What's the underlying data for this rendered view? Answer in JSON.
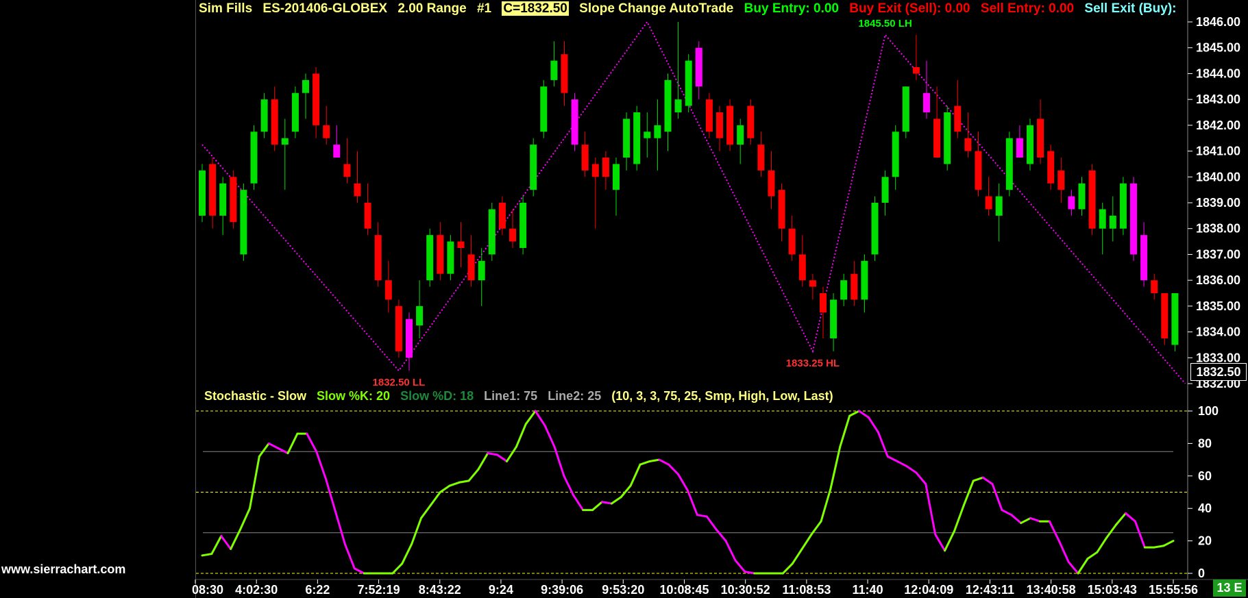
{
  "watermark": "www.sierrachart.com",
  "header": {
    "sim": "Sim Fills",
    "symbol": "ES-201406-GLOBEX",
    "range": "2.00 Range",
    "chart_num": "#1",
    "close": "C=1832.50",
    "study": "Slope Change AutoTrade",
    "buy_entry": "Buy Entry: 0.00",
    "buy_exit": "Buy Exit (Sell): 0.00",
    "sell_entry": "Sell Entry: 0.00",
    "sell_exit": "Sell Exit (Buy):"
  },
  "stoch_header": {
    "name": "Stochastic - Slow",
    "k": "Slow %K: 20",
    "d": "Slow %D: 18",
    "line1": "Line1: 75",
    "line2": "Line2: 25",
    "params": "(10, 3, 3, 75, 25, Smp, High, Low, Last)"
  },
  "current_price": "1832.50",
  "bar_count": "13 E",
  "colors": {
    "up": "#00e000",
    "down": "#ff0000",
    "magenta": "#ff00ff",
    "stoch_up": "#80ff00",
    "header_green": "#00ff00",
    "header_red": "#ff0000",
    "header_cyan": "#80ffff",
    "header_yellow": "#ffff80"
  },
  "chart_data": [
    {
      "type": "candlestick",
      "yaxis_ticks": [
        1846,
        1845,
        1844,
        1843,
        1842,
        1841,
        1840,
        1839,
        1838,
        1837,
        1836,
        1835,
        1834,
        1833,
        1832
      ],
      "ylim": [
        1832,
        1846
      ],
      "x_ticks": [
        "08:30",
        "4:02:30",
        "6:22",
        "7:52:19",
        "8:43:22",
        "9:24",
        "9:39:06",
        "9:53:20",
        "10:08:45",
        "10:30:52",
        "11:08:53",
        "11:40",
        "12:04:09",
        "12:43:11",
        "13:40:58",
        "15:03:43",
        "15:55:56"
      ],
      "swing_labels": [
        {
          "text": "1832.50 LL",
          "price": 1832.5,
          "color": "#ff3030"
        },
        {
          "text": "1845.50 LH",
          "price": 1845.5,
          "color": "#00ff00"
        },
        {
          "text": "1833.25 HL",
          "price": 1833.25,
          "color": "#ff3030"
        }
      ],
      "zigzag": [
        {
          "bar": 0,
          "price": 1841.25
        },
        {
          "bar": 19,
          "price": 1832.5
        },
        {
          "bar": 43,
          "price": 1846.0
        },
        {
          "bar": 59,
          "price": 1833.25
        },
        {
          "bar": 66,
          "price": 1845.5
        },
        {
          "bar": 95,
          "price": 1832.0
        }
      ],
      "candles": [
        {
          "o": 1838.5,
          "h": 1840.5,
          "l": 1838.25,
          "c": 1840.25,
          "k": "up"
        },
        {
          "o": 1840.5,
          "h": 1840.75,
          "l": 1838.0,
          "c": 1838.5,
          "k": "down"
        },
        {
          "o": 1838.5,
          "h": 1840.0,
          "l": 1837.75,
          "c": 1839.75,
          "k": "up"
        },
        {
          "o": 1840.0,
          "h": 1840.25,
          "l": 1838.0,
          "c": 1838.25,
          "k": "down"
        },
        {
          "o": 1837.0,
          "h": 1839.75,
          "l": 1836.75,
          "c": 1839.5,
          "k": "up"
        },
        {
          "o": 1839.75,
          "h": 1842.0,
          "l": 1839.5,
          "c": 1841.75,
          "k": "up"
        },
        {
          "o": 1841.75,
          "h": 1843.25,
          "l": 1841.5,
          "c": 1843.0,
          "k": "up"
        },
        {
          "o": 1843.0,
          "h": 1843.5,
          "l": 1841.0,
          "c": 1841.25,
          "k": "down"
        },
        {
          "o": 1841.25,
          "h": 1842.25,
          "l": 1839.5,
          "c": 1841.5,
          "k": "up"
        },
        {
          "o": 1841.75,
          "h": 1843.5,
          "l": 1841.5,
          "c": 1843.25,
          "k": "up"
        },
        {
          "o": 1843.25,
          "h": 1844.0,
          "l": 1842.25,
          "c": 1843.75,
          "k": "up"
        },
        {
          "o": 1844.0,
          "h": 1844.25,
          "l": 1841.5,
          "c": 1842.0,
          "k": "down"
        },
        {
          "o": 1842.0,
          "h": 1842.75,
          "l": 1841.25,
          "c": 1841.5,
          "k": "down"
        },
        {
          "o": 1841.25,
          "h": 1842.0,
          "l": 1840.75,
          "c": 1840.75,
          "k": "magenta"
        },
        {
          "o": 1840.5,
          "h": 1841.5,
          "l": 1839.75,
          "c": 1840.0,
          "k": "down"
        },
        {
          "o": 1839.75,
          "h": 1841.0,
          "l": 1839.0,
          "c": 1839.25,
          "k": "down"
        },
        {
          "o": 1839.0,
          "h": 1839.75,
          "l": 1837.75,
          "c": 1838.0,
          "k": "down"
        },
        {
          "o": 1837.75,
          "h": 1838.25,
          "l": 1835.75,
          "c": 1836.0,
          "k": "down"
        },
        {
          "o": 1836.0,
          "h": 1836.75,
          "l": 1834.75,
          "c": 1835.25,
          "k": "down"
        },
        {
          "o": 1835.0,
          "h": 1835.25,
          "l": 1833.0,
          "c": 1833.25,
          "k": "down"
        },
        {
          "o": 1834.5,
          "h": 1834.75,
          "l": 1832.5,
          "c": 1833.0,
          "k": "magenta"
        },
        {
          "o": 1834.25,
          "h": 1836.0,
          "l": 1833.75,
          "c": 1835.0,
          "k": "up"
        },
        {
          "o": 1836.0,
          "h": 1838.0,
          "l": 1835.75,
          "c": 1837.75,
          "k": "up"
        },
        {
          "o": 1837.75,
          "h": 1838.25,
          "l": 1836.0,
          "c": 1836.25,
          "k": "down"
        },
        {
          "o": 1836.25,
          "h": 1837.75,
          "l": 1836.0,
          "c": 1837.5,
          "k": "up"
        },
        {
          "o": 1837.5,
          "h": 1838.25,
          "l": 1836.5,
          "c": 1837.25,
          "k": "down"
        },
        {
          "o": 1837.0,
          "h": 1837.75,
          "l": 1835.75,
          "c": 1836.0,
          "k": "down"
        },
        {
          "o": 1836.0,
          "h": 1837.25,
          "l": 1835.0,
          "c": 1836.75,
          "k": "up"
        },
        {
          "o": 1837.0,
          "h": 1839.0,
          "l": 1836.75,
          "c": 1838.75,
          "k": "up"
        },
        {
          "o": 1839.0,
          "h": 1839.25,
          "l": 1837.75,
          "c": 1838.0,
          "k": "down"
        },
        {
          "o": 1838.0,
          "h": 1838.75,
          "l": 1837.25,
          "c": 1837.5,
          "k": "down"
        },
        {
          "o": 1837.25,
          "h": 1839.25,
          "l": 1837.0,
          "c": 1839.0,
          "k": "up"
        },
        {
          "o": 1839.5,
          "h": 1841.5,
          "l": 1839.25,
          "c": 1841.25,
          "k": "up"
        },
        {
          "o": 1841.75,
          "h": 1843.75,
          "l": 1841.5,
          "c": 1843.5,
          "k": "up"
        },
        {
          "o": 1843.75,
          "h": 1845.25,
          "l": 1843.5,
          "c": 1844.5,
          "k": "up"
        },
        {
          "o": 1844.75,
          "h": 1845.25,
          "l": 1842.75,
          "c": 1843.25,
          "k": "down"
        },
        {
          "o": 1843.0,
          "h": 1843.25,
          "l": 1841.0,
          "c": 1841.25,
          "k": "magenta"
        },
        {
          "o": 1841.25,
          "h": 1841.75,
          "l": 1840.0,
          "c": 1840.25,
          "k": "down"
        },
        {
          "o": 1840.5,
          "h": 1840.75,
          "l": 1838.0,
          "c": 1840.0,
          "k": "down"
        },
        {
          "o": 1840.0,
          "h": 1841.0,
          "l": 1839.5,
          "c": 1840.75,
          "k": "down"
        },
        {
          "o": 1839.5,
          "h": 1840.75,
          "l": 1838.5,
          "c": 1840.5,
          "k": "up"
        },
        {
          "o": 1840.75,
          "h": 1842.5,
          "l": 1840.25,
          "c": 1842.25,
          "k": "up"
        },
        {
          "o": 1840.5,
          "h": 1842.75,
          "l": 1840.25,
          "c": 1842.5,
          "k": "up"
        },
        {
          "o": 1841.5,
          "h": 1842.5,
          "l": 1840.75,
          "c": 1841.75,
          "k": "up"
        },
        {
          "o": 1842.0,
          "h": 1843.0,
          "l": 1840.25,
          "c": 1841.5,
          "k": "up"
        },
        {
          "o": 1841.75,
          "h": 1844.0,
          "l": 1841.0,
          "c": 1843.75,
          "k": "up"
        },
        {
          "o": 1843.0,
          "h": 1846.0,
          "l": 1842.25,
          "c": 1842.5,
          "k": "up"
        },
        {
          "o": 1842.75,
          "h": 1844.75,
          "l": 1842.5,
          "c": 1844.5,
          "k": "up"
        },
        {
          "o": 1845.0,
          "h": 1845.25,
          "l": 1843.0,
          "c": 1843.5,
          "k": "magenta"
        },
        {
          "o": 1843.0,
          "h": 1843.25,
          "l": 1841.5,
          "c": 1841.75,
          "k": "down"
        },
        {
          "o": 1841.5,
          "h": 1842.75,
          "l": 1841.0,
          "c": 1842.5,
          "k": "down"
        },
        {
          "o": 1842.75,
          "h": 1843.0,
          "l": 1841.0,
          "c": 1841.25,
          "k": "down"
        },
        {
          "o": 1841.25,
          "h": 1842.25,
          "l": 1840.5,
          "c": 1842.0,
          "k": "up"
        },
        {
          "o": 1842.75,
          "h": 1843.0,
          "l": 1841.25,
          "c": 1841.5,
          "k": "down"
        },
        {
          "o": 1841.25,
          "h": 1841.75,
          "l": 1840.0,
          "c": 1840.25,
          "k": "down"
        },
        {
          "o": 1840.25,
          "h": 1841.0,
          "l": 1838.75,
          "c": 1839.25,
          "k": "down"
        },
        {
          "o": 1839.5,
          "h": 1839.75,
          "l": 1837.5,
          "c": 1838.0,
          "k": "down"
        },
        {
          "o": 1838.0,
          "h": 1838.5,
          "l": 1836.75,
          "c": 1837.0,
          "k": "down"
        },
        {
          "o": 1837.0,
          "h": 1837.75,
          "l": 1835.75,
          "c": 1836.0,
          "k": "down"
        },
        {
          "o": 1836.0,
          "h": 1836.25,
          "l": 1835.25,
          "c": 1835.75,
          "k": "down"
        },
        {
          "o": 1835.5,
          "h": 1835.75,
          "l": 1833.75,
          "c": 1834.75,
          "k": "down"
        },
        {
          "o": 1833.75,
          "h": 1835.5,
          "l": 1833.25,
          "c": 1835.25,
          "k": "up"
        },
        {
          "o": 1835.25,
          "h": 1836.25,
          "l": 1835.0,
          "c": 1836.0,
          "k": "up"
        },
        {
          "o": 1836.25,
          "h": 1836.75,
          "l": 1835.0,
          "c": 1835.25,
          "k": "down"
        },
        {
          "o": 1835.25,
          "h": 1837.0,
          "l": 1834.75,
          "c": 1836.75,
          "k": "up"
        },
        {
          "o": 1837.0,
          "h": 1839.25,
          "l": 1836.75,
          "c": 1839.0,
          "k": "up"
        },
        {
          "o": 1839.0,
          "h": 1840.25,
          "l": 1838.5,
          "c": 1840.0,
          "k": "up"
        },
        {
          "o": 1840.0,
          "h": 1842.0,
          "l": 1839.5,
          "c": 1841.75,
          "k": "up"
        },
        {
          "o": 1841.75,
          "h": 1843.5,
          "l": 1841.5,
          "c": 1843.5,
          "k": "up"
        },
        {
          "o": 1844.25,
          "h": 1845.5,
          "l": 1843.75,
          "c": 1844.0,
          "k": "down"
        },
        {
          "o": 1843.25,
          "h": 1844.5,
          "l": 1842.25,
          "c": 1842.5,
          "k": "magenta"
        },
        {
          "o": 1842.25,
          "h": 1843.5,
          "l": 1840.75,
          "c": 1840.75,
          "k": "down"
        },
        {
          "o": 1840.5,
          "h": 1842.75,
          "l": 1840.25,
          "c": 1842.5,
          "k": "up"
        },
        {
          "o": 1842.75,
          "h": 1843.75,
          "l": 1841.5,
          "c": 1841.75,
          "k": "down"
        },
        {
          "o": 1841.5,
          "h": 1842.5,
          "l": 1840.75,
          "c": 1841.0,
          "k": "down"
        },
        {
          "o": 1841.0,
          "h": 1841.75,
          "l": 1839.25,
          "c": 1839.5,
          "k": "down"
        },
        {
          "o": 1839.25,
          "h": 1840.0,
          "l": 1838.5,
          "c": 1838.75,
          "k": "down"
        },
        {
          "o": 1838.5,
          "h": 1839.75,
          "l": 1837.5,
          "c": 1839.25,
          "k": "up"
        },
        {
          "o": 1839.5,
          "h": 1841.75,
          "l": 1839.25,
          "c": 1841.5,
          "k": "up"
        },
        {
          "o": 1841.5,
          "h": 1842.0,
          "l": 1840.75,
          "c": 1840.75,
          "k": "magenta"
        },
        {
          "o": 1840.5,
          "h": 1842.25,
          "l": 1840.25,
          "c": 1842.0,
          "k": "up"
        },
        {
          "o": 1842.25,
          "h": 1843.0,
          "l": 1840.5,
          "c": 1840.75,
          "k": "down"
        },
        {
          "o": 1841.0,
          "h": 1841.25,
          "l": 1839.5,
          "c": 1839.75,
          "k": "down"
        },
        {
          "o": 1839.5,
          "h": 1840.75,
          "l": 1839.0,
          "c": 1840.25,
          "k": "down"
        },
        {
          "o": 1839.25,
          "h": 1839.5,
          "l": 1838.5,
          "c": 1838.75,
          "k": "magenta"
        },
        {
          "o": 1838.75,
          "h": 1840.0,
          "l": 1838.5,
          "c": 1839.75,
          "k": "up"
        },
        {
          "o": 1840.25,
          "h": 1840.5,
          "l": 1837.75,
          "c": 1838.0,
          "k": "down"
        },
        {
          "o": 1838.0,
          "h": 1839.0,
          "l": 1837.0,
          "c": 1838.75,
          "k": "up"
        },
        {
          "o": 1838.5,
          "h": 1839.25,
          "l": 1837.5,
          "c": 1838.0,
          "k": "up"
        },
        {
          "o": 1839.75,
          "h": 1840.0,
          "l": 1837.75,
          "c": 1838.0,
          "k": "up"
        },
        {
          "o": 1839.75,
          "h": 1840.0,
          "l": 1836.75,
          "c": 1837.0,
          "k": "magenta"
        },
        {
          "o": 1837.75,
          "h": 1838.25,
          "l": 1835.75,
          "c": 1836.0,
          "k": "magenta"
        },
        {
          "o": 1836.0,
          "h": 1836.25,
          "l": 1835.25,
          "c": 1835.5,
          "k": "down"
        },
        {
          "o": 1835.5,
          "h": 1835.5,
          "l": 1833.5,
          "c": 1833.75,
          "k": "down"
        },
        {
          "o": 1833.5,
          "h": 1835.5,
          "l": 1833.25,
          "c": 1835.5,
          "k": "up"
        }
      ]
    },
    {
      "type": "line",
      "title": "Stochastic - Slow",
      "ylim": [
        0,
        100
      ],
      "yaxis_ticks": [
        100,
        80,
        60,
        40,
        20,
        0
      ],
      "reference_lines": [
        {
          "value": 100,
          "style": "dashed",
          "color": "#ffff00"
        },
        {
          "value": 75,
          "style": "solid",
          "color": "#888888"
        },
        {
          "value": 50,
          "style": "dashed",
          "color": "#ffff00"
        },
        {
          "value": 25,
          "style": "solid",
          "color": "#888888"
        },
        {
          "value": 0,
          "style": "dashed",
          "color": "#ffff00"
        }
      ],
      "series": [
        {
          "name": "Slow %K",
          "values": [
            11,
            12,
            23,
            15,
            27,
            40,
            72,
            80,
            77,
            74,
            86,
            86,
            75,
            58,
            38,
            18,
            3,
            0,
            0,
            0,
            0,
            6,
            18,
            34,
            42,
            50,
            54,
            56,
            57,
            64,
            74,
            73,
            69,
            78,
            92,
            100,
            91,
            78,
            60,
            48,
            39,
            39,
            44,
            43,
            47,
            54,
            67,
            69,
            70,
            67,
            61,
            51,
            36,
            35,
            27,
            20,
            8,
            1,
            0,
            0,
            0,
            0,
            6,
            15,
            24,
            32,
            52,
            78,
            97,
            100,
            96,
            87,
            72,
            69,
            66,
            62,
            55,
            24,
            14,
            26,
            42,
            57,
            59,
            55,
            39,
            36,
            31,
            34,
            32,
            32,
            20,
            7,
            0,
            9,
            13,
            22,
            30,
            37,
            32,
            16,
            16,
            17,
            20
          ]
        }
      ]
    }
  ]
}
